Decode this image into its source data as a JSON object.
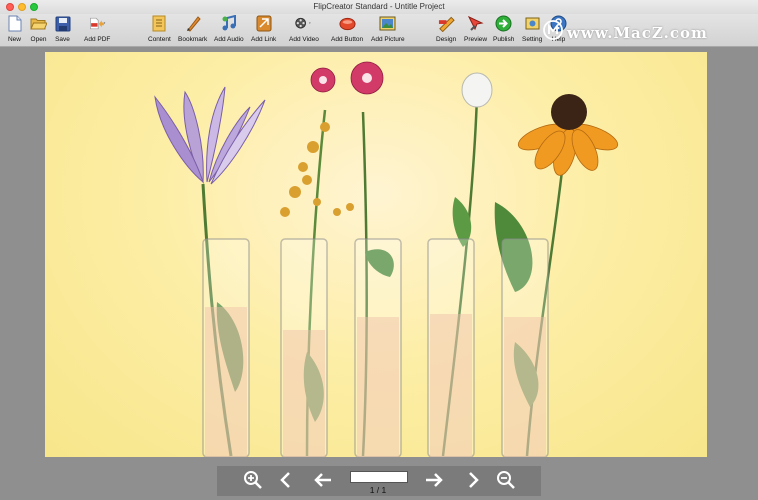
{
  "window": {
    "title": "FlipCreator Standard - Untitle Project"
  },
  "toolbar": {
    "new": "New",
    "open": "Open",
    "save": "Save",
    "add_pdf": "Add PDF",
    "content": "Content",
    "bookmark": "Bookmark",
    "add_audio": "Add Audio",
    "add_link": "Add Link",
    "add_video": "Add Video",
    "add_button": "Add Button",
    "add_picture": "Add Picture",
    "design": "Design",
    "preview": "Preview",
    "publish": "Publish",
    "setting": "Setting",
    "help": "Help"
  },
  "watermark": {
    "text": "www.MacZ.com"
  },
  "navigation": {
    "page_input_value": "",
    "page_indicator": "1 / 1"
  },
  "colors": {
    "page_background": "#fdeea7",
    "accent_publish": "#2fae3a",
    "nav_bar": "#7b7b7b"
  },
  "icons": [
    "new-document-icon",
    "open-folder-icon",
    "save-disk-icon",
    "add-pdf-icon",
    "content-icon",
    "bookmark-icon",
    "add-audio-icon",
    "add-link-icon",
    "add-video-icon",
    "add-button-icon",
    "add-picture-icon",
    "design-icon",
    "preview-icon",
    "publish-icon",
    "setting-icon",
    "help-icon",
    "zoom-in-icon",
    "first-page-icon",
    "previous-page-icon",
    "next-page-icon",
    "last-page-icon",
    "zoom-out-icon"
  ]
}
